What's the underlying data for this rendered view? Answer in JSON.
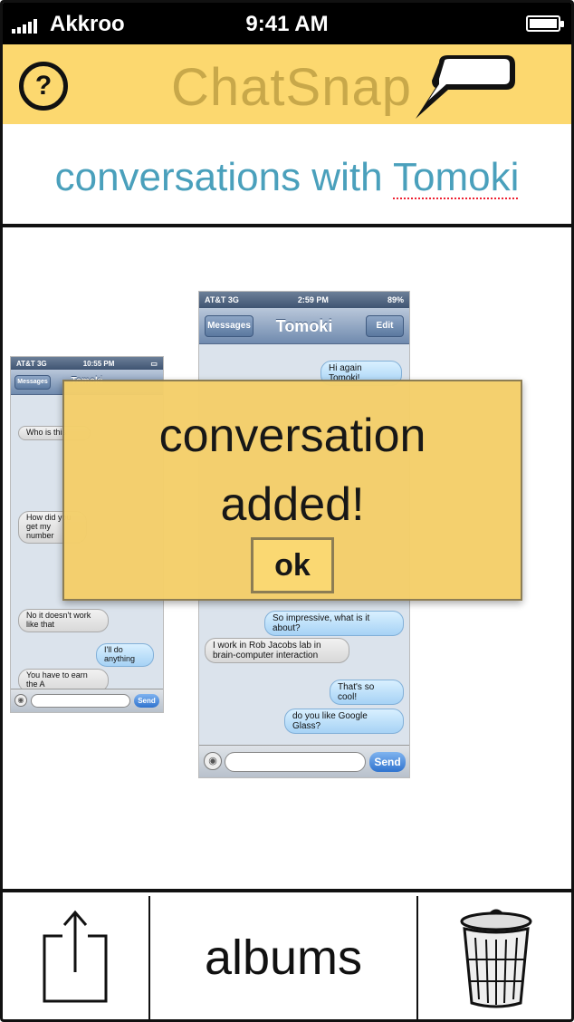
{
  "status_bar": {
    "carrier": "Akkroo",
    "time": "9:41 AM"
  },
  "header": {
    "app_name": "ChatSnap",
    "help_label": "?"
  },
  "page_title": {
    "prefix": "conversations with ",
    "contact": "Tomoki"
  },
  "screenshot_left": {
    "carrier": "AT&T 3G",
    "time": "10:55 PM",
    "back_label": "Messages",
    "nav_title": "Tomoki",
    "messages": [
      {
        "from": "them",
        "text": "Who is this"
      },
      {
        "from": "them",
        "text": "How did you get my number"
      },
      {
        "from": "them",
        "text": "No it doesn't work like that"
      },
      {
        "from": "me",
        "text": "I'll do anything"
      },
      {
        "from": "them",
        "text": "You have to earn the A"
      }
    ],
    "send_label": "Send"
  },
  "screenshot_right": {
    "carrier": "AT&T 3G",
    "time": "2:59 PM",
    "battery": "89%",
    "back_label": "Messages",
    "nav_title": "Tomoki",
    "edit_label": "Edit",
    "messages": [
      {
        "from": "me",
        "text": "Hi again Tomoki!"
      },
      {
        "from": "me",
        "text": "So impressive, what is it about?"
      },
      {
        "from": "them",
        "text": "I work in Rob Jacobs lab in brain-computer interaction"
      },
      {
        "from": "me",
        "text": "That's so cool!"
      },
      {
        "from": "me",
        "text": "do you like Google Glass?"
      }
    ],
    "send_label": "Send"
  },
  "dialog": {
    "line1": "conversation",
    "line2": "added!",
    "ok_label": "ok"
  },
  "footer": {
    "albums_label": "albums",
    "share_icon": "share-icon",
    "trash_icon": "trash-icon"
  },
  "colors": {
    "header_bg": "#fcd86f",
    "brand_text": "#c8a84a",
    "title_text": "#4aa0bc",
    "dialog_bg": "#f4cf6a"
  }
}
